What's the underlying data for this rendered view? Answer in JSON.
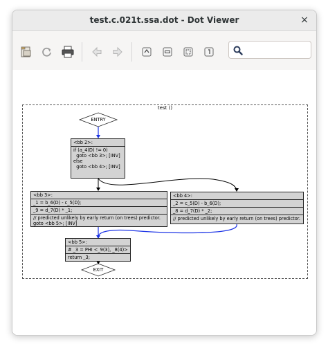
{
  "window": {
    "title": "test.c.021t.ssa.dot - Dot Viewer",
    "close_glyph": "×"
  },
  "toolbar": {
    "buttons": [
      {
        "name": "open-icon"
      },
      {
        "name": "reload-icon"
      },
      {
        "name": "print-icon"
      },
      {
        "name": "back-icon"
      },
      {
        "name": "forward-icon"
      },
      {
        "name": "zoom-in-icon"
      },
      {
        "name": "zoom-out-icon"
      },
      {
        "name": "zoom-fit-icon"
      },
      {
        "name": "zoom-100-icon"
      }
    ],
    "search": {
      "value": "",
      "placeholder": ""
    }
  },
  "graph": {
    "cluster_label": "test ()",
    "entry_label": "ENTRY",
    "exit_label": "EXIT",
    "bb2": {
      "header": "<bb 2>:",
      "body": "if (a_4(D) != 0)\n  goto <bb 3>; [INV]\nelse\n  goto <bb 4>; [INV]"
    },
    "bb3": {
      "header": "<bb 3>:",
      "line1": "_1 = b_6(D) - c_5(D);",
      "line2": "_9 = d_7(D) * _1;",
      "line3": "// predicted unlikely by early return (on trees) predictor.",
      "line4": "goto <bb 5>; [INV]"
    },
    "bb4": {
      "header": "<bb 4>:",
      "line1": "_2 = c_5(D) - b_6(D);",
      "line2": "_8 = d_7(D) * _2;",
      "line3": "// predicted unlikely by early return (on trees) predictor."
    },
    "bb5": {
      "header": "<bb 5>:",
      "line1": "# _3 = PHI <_9(3), _8(4)>",
      "line2": "return _3;"
    },
    "colors": {
      "fallthru_edge": "#1a32e6",
      "branch_edge": "#000000",
      "node_fill": "#d3d3d3"
    }
  }
}
